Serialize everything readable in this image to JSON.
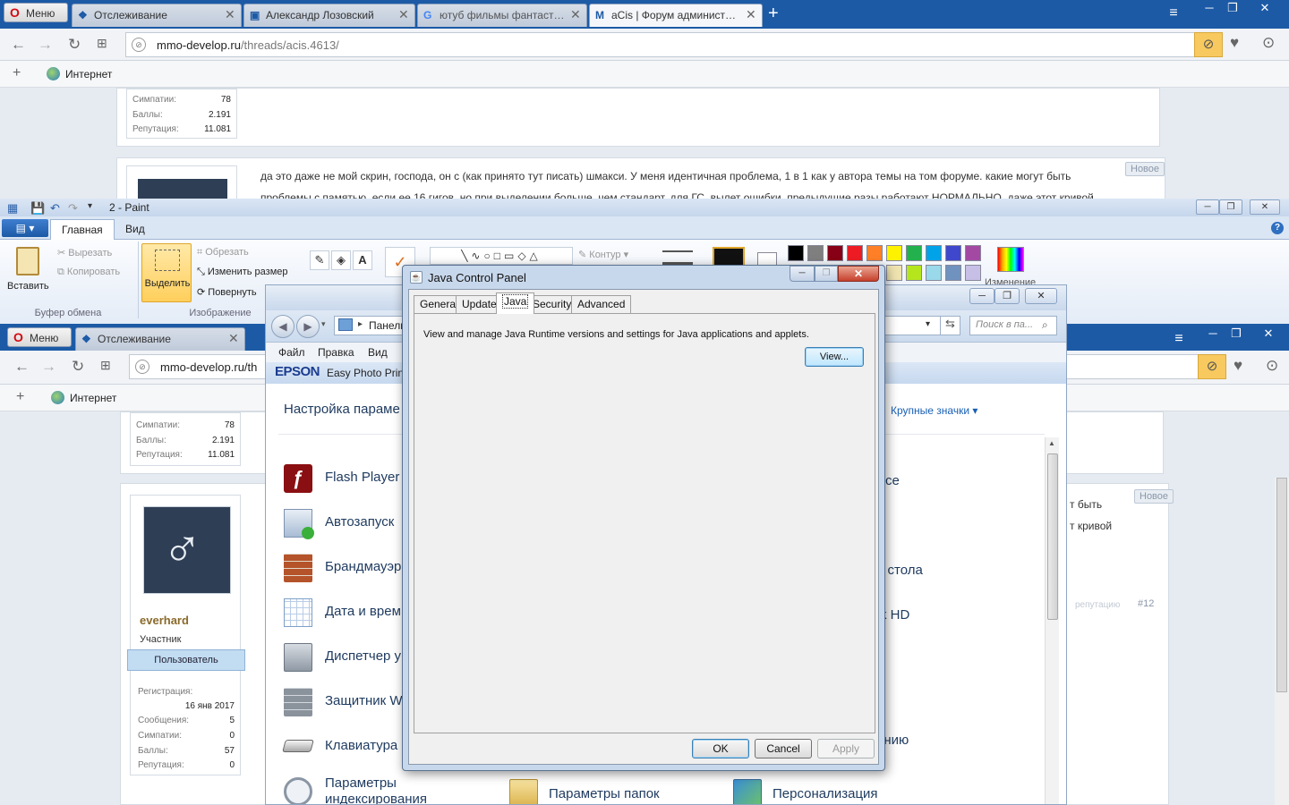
{
  "opera_top": {
    "menu_label": "Меню",
    "tabs": [
      {
        "label": "Отслеживание",
        "icon": "opera-watch-icon"
      },
      {
        "label": "Александр Лозовский",
        "icon": "page-icon"
      },
      {
        "label": "ютуб фильмы фантастика",
        "icon": "google-icon"
      },
      {
        "label": "aCis | Форум администрат",
        "icon": "forum-icon"
      }
    ],
    "url_host": "mmo-develop.ru",
    "url_path": "/threads/acis.4613/",
    "bookmark_label": "Интернет",
    "stats": [
      {
        "label": "Симпатии:",
        "value": "78"
      },
      {
        "label": "Баллы:",
        "value": "2.191"
      },
      {
        "label": "Репутация:",
        "value": "11.081"
      }
    ],
    "post_line1": "да это даже не мой скрин, господа, он с (как принято тут писать) шмакси. У меня идентичная проблема, 1 в 1 как у автора темы на том форуме. какие могут быть",
    "post_line2": "проблемы с памятью, если ее 16 гигов, но при выделении больше, чем стандарт, для ГС, вылет ошибки. предыдущие разы работают НОРМАЛЬНО, даже этот кривой",
    "new_badge": "Новое"
  },
  "paint": {
    "title": "2 - Paint",
    "tabs": [
      "Главная",
      "Вид"
    ],
    "paste_label": "Вставить",
    "cut_label": "Вырезать",
    "copy_label": "Копировать",
    "clipboard_group": "Буфер обмена",
    "select_label": "Выделить",
    "crop_label": "Обрезать",
    "resize_label": "Изменить размер",
    "rotate_label": "Повернуть",
    "image_group": "Изображение",
    "outline_label": "Контур",
    "edit_colors_label": "Изменение",
    "palette_row1": [
      "#000000",
      "#7f7f7f",
      "#880015",
      "#ed1c24",
      "#ff7f27",
      "#fff200",
      "#22b14c",
      "#00a2e8",
      "#3f48cc",
      "#a349a4"
    ],
    "palette_row2": [
      "#ffffff",
      "#c3c3c3",
      "#b97a57",
      "#ffaec9",
      "#ffc90e",
      "#efe4b0",
      "#b5e61d",
      "#99d9ea",
      "#7092be",
      "#c8bfe7"
    ]
  },
  "opera_second": {
    "menu_label": "Меню",
    "tab_label": "Отслеживание",
    "url_host": "mmo-develop.ru/th",
    "bookmark_label": "Интернет",
    "stats_top": [
      {
        "label": "Симпатии:",
        "value": "78"
      },
      {
        "label": "Баллы:",
        "value": "2.191"
      },
      {
        "label": "Репутация:",
        "value": "11.081"
      }
    ],
    "username": "everhard",
    "user_title": "Участник",
    "user_role": "Пользователь",
    "reg_label": "Регистрация:",
    "reg_date": "16 янв 2017",
    "user_stats": [
      {
        "label": "Сообщения:",
        "value": "5"
      },
      {
        "label": "Симпатии:",
        "value": "0"
      },
      {
        "label": "Баллы:",
        "value": "57"
      },
      {
        "label": "Репутация:",
        "value": "0"
      }
    ],
    "post_frag1": "т быть",
    "post_frag2": "т кривой",
    "post_frag_top": "т кривой",
    "new_badge": "Новое",
    "reputation_link": "репутацию",
    "post_number": "#12"
  },
  "control_panel": {
    "path": "Панель",
    "search_placeholder": "Поиск в па...",
    "menu": [
      "Файл",
      "Правка",
      "Вид"
    ],
    "epson_logo": "EPSON",
    "epson_text": "Easy Photo Print",
    "heading": "Настройка параме",
    "view_by": "Крупные значки",
    "items_left": [
      {
        "label": "Flash Player",
        "icon": "flash-icon"
      },
      {
        "label": "Автозапуск",
        "icon": "autoplay-icon"
      },
      {
        "label": "Брандмауэр",
        "icon": "firewall-icon"
      },
      {
        "label": "Дата и врем",
        "icon": "calendar-icon"
      },
      {
        "label": "Диспетчер у",
        "icon": "device-manager-icon"
      },
      {
        "label": "Защитник W",
        "icon": "defender-icon"
      },
      {
        "label": "Клавиатура",
        "icon": "keyboard-icon"
      },
      {
        "label": "Параметры индексирования",
        "icon": "indexing-icon"
      }
    ],
    "items_right_fragments": [
      "ce",
      "о стола",
      "k HD",
      "ению"
    ],
    "bottom_mid": "Параметры папок",
    "bottom_right": "Персонализация"
  },
  "java_dialog": {
    "title": "Java Control Panel",
    "tabs": [
      "General",
      "Update",
      "Java",
      "Security",
      "Advanced"
    ],
    "description": "View and manage Java Runtime versions and settings for Java applications and applets.",
    "view_button": "View...",
    "ok": "OK",
    "cancel": "Cancel",
    "apply": "Apply"
  }
}
